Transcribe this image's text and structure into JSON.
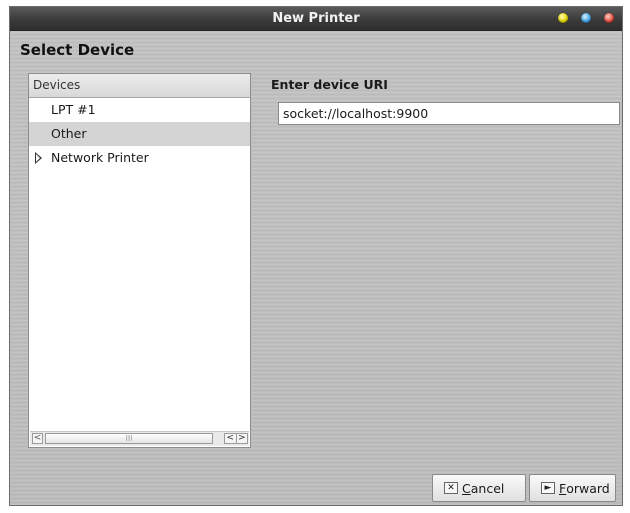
{
  "window": {
    "title": "New Printer",
    "controls": {
      "minimize_color": "#e8d800",
      "maximize_color": "#3ea2e8",
      "close_color": "#e84a3a"
    }
  },
  "page": {
    "heading": "Select Device"
  },
  "devices": {
    "header": "Devices",
    "items": [
      {
        "label": "LPT #1",
        "selected": false,
        "expandable": false
      },
      {
        "label": "Other",
        "selected": true,
        "expandable": false
      },
      {
        "label": "Network Printer",
        "selected": false,
        "expandable": true
      }
    ],
    "scrollbar": {
      "thumb_grip": "III",
      "left_arrow": "<",
      "right_arrow": ">"
    }
  },
  "uri": {
    "label": "Enter device URI",
    "value": "socket://localhost:9900",
    "placeholder": ""
  },
  "buttons": {
    "cancel": {
      "mnemonic": "C",
      "rest": "ancel",
      "icon": "cancel-x-icon",
      "icon_glyph": "✕"
    },
    "forward": {
      "mnemonic": "F",
      "rest": "orward",
      "icon": "forward-arrow-icon",
      "icon_glyph": "►"
    }
  }
}
